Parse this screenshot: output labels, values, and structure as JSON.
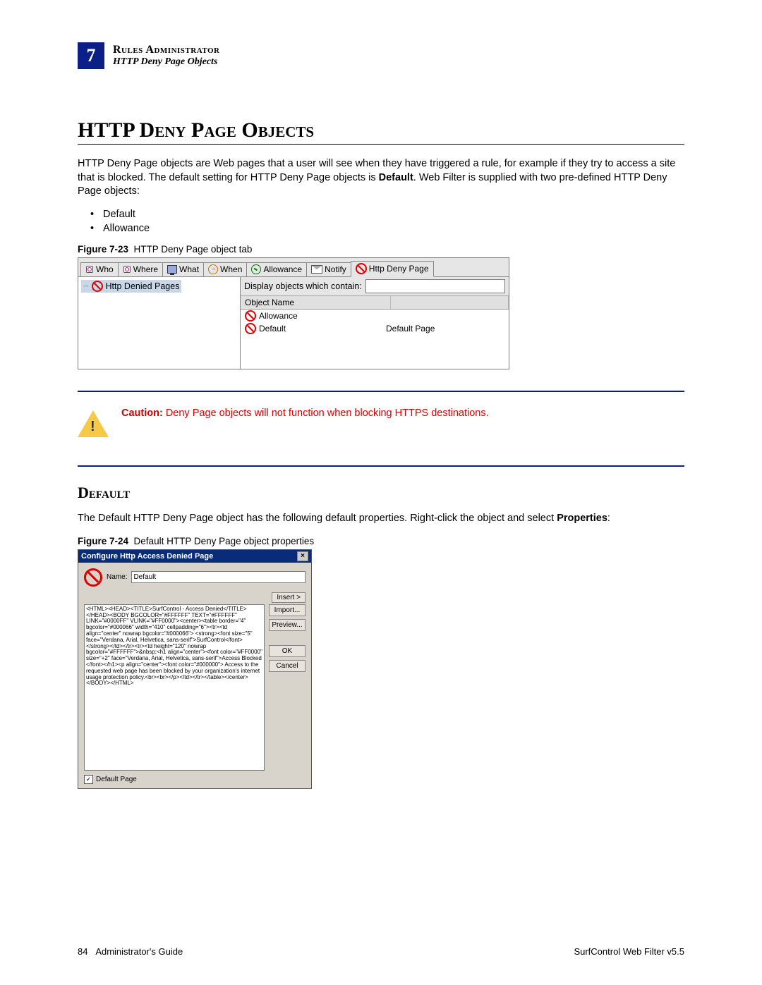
{
  "header": {
    "chapter_number": "7",
    "line1": "Rules Administrator",
    "line2": "HTTP Deny Page Objects"
  },
  "title": "HTTP Deny Page Objects",
  "intro_para_before_bold": "HTTP Deny Page objects are Web pages that a user will see when they have triggered a rule, for example if they try to access a site that is blocked. The default setting for HTTP Deny Page objects is ",
  "intro_bold": "Default",
  "intro_para_after": ". Web Filter is supplied with two pre-defined HTTP Deny Page objects:",
  "bullets": [
    "Default",
    "Allowance"
  ],
  "figure23": {
    "label": "Figure 7-23",
    "caption": "HTTP Deny Page object tab",
    "tabs": [
      {
        "label": "Who"
      },
      {
        "label": "Where"
      },
      {
        "label": "What"
      },
      {
        "label": "When"
      },
      {
        "label": "Allowance"
      },
      {
        "label": "Notify"
      },
      {
        "label": "Http Deny Page",
        "active": true
      }
    ],
    "tree_root": "Http Denied Pages",
    "filter_label": "Display objects which contain:",
    "columns": {
      "name": "Object Name",
      "desc": ""
    },
    "rows": [
      {
        "name": "Allowance",
        "desc": ""
      },
      {
        "name": "Default",
        "desc": "Default Page"
      }
    ]
  },
  "caution": {
    "label": "Caution:",
    "text": "Deny Page objects will not function when blocking HTTPS destinations."
  },
  "section_default": {
    "heading": "Default",
    "para_before_bold": "The Default HTTP Deny Page object has the following default properties. Right-click the object and select ",
    "bold": "Properties",
    "after": ":"
  },
  "figure24": {
    "label": "Figure 7-24",
    "caption": "Default HTTP Deny Page object properties",
    "dialog_title": "Configure Http Access Denied Page",
    "name_label": "Name:",
    "name_value": "Default",
    "insert_btn": "Insert >",
    "html_content": "<HTML><HEAD><TITLE>SurfControl - Access Denied</TITLE></HEAD><BODY BGCOLOR=\"#FFFFFF\" TEXT=\"#FFFFFF\" LINK=\"#0000FF\" VLINK=\"#FF0000\"><center><table border=\"4\" bgcolor=\"#000066\" width=\"410\" cellpadding=\"6\"><tr><td align=\"center\" nowrap bgcolor=\"#000066\"> <strong><font size=\"5\" face=\"Verdana, Arial, Helvetica, sans-serif\">SurfControl</font></strong></td></tr><tr><td height=\"120\" nowrap bgcolor=\"#FFFFFF\">&nbsp;<h1 align=\"center\"><font color=\"#FF0000\" size=\"+2\" face=\"Verdana, Arial, Helvetica, sans-serif\">Access Blocked </font></h1><p align=\"center\"><font color=\"#000000\"> Access to the requested web page has been blocked by your organization's internet usage protection policy.<br><br></p></td></tr></table></center></BODY></HTML>",
    "buttons": [
      "Import...",
      "Preview...",
      "OK",
      "Cancel"
    ],
    "checkbox_label": "Default Page",
    "checkbox_checked": true
  },
  "footer": {
    "page_number": "84",
    "left": "Administrator's Guide",
    "right": "SurfControl Web Filter v5.5"
  }
}
